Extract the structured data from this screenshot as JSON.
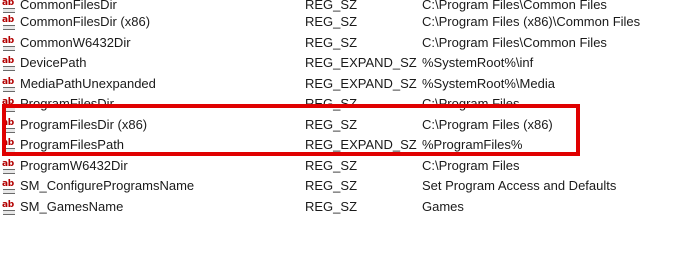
{
  "entries": [
    {
      "name": "CommonFilesDir",
      "type": "REG_SZ",
      "data": "C:\\Program Files\\Common Files"
    },
    {
      "name": "CommonFilesDir (x86)",
      "type": "REG_SZ",
      "data": "C:\\Program Files (x86)\\Common Files"
    },
    {
      "name": "CommonW6432Dir",
      "type": "REG_SZ",
      "data": "C:\\Program Files\\Common Files"
    },
    {
      "name": "DevicePath",
      "type": "REG_EXPAND_SZ",
      "data": "%SystemRoot%\\inf"
    },
    {
      "name": "MediaPathUnexpanded",
      "type": "REG_EXPAND_SZ",
      "data": "%SystemRoot%\\Media"
    },
    {
      "name": "ProgramFilesDir",
      "type": "REG_SZ",
      "data": "C:\\Program Files"
    },
    {
      "name": "ProgramFilesDir (x86)",
      "type": "REG_SZ",
      "data": "C:\\Program Files (x86)"
    },
    {
      "name": "ProgramFilesPath",
      "type": "REG_EXPAND_SZ",
      "data": "%ProgramFiles%"
    },
    {
      "name": "ProgramW6432Dir",
      "type": "REG_SZ",
      "data": "C:\\Program Files"
    },
    {
      "name": "SM_ConfigureProgramsName",
      "type": "REG_SZ",
      "data": "Set Program Access and Defaults"
    },
    {
      "name": "SM_GamesName",
      "type": "REG_SZ",
      "data": "Games"
    }
  ],
  "icon": {
    "name": "string-value-icon",
    "label": "ab",
    "color": "#b30000"
  },
  "highlight": {
    "color": "#e00000"
  }
}
